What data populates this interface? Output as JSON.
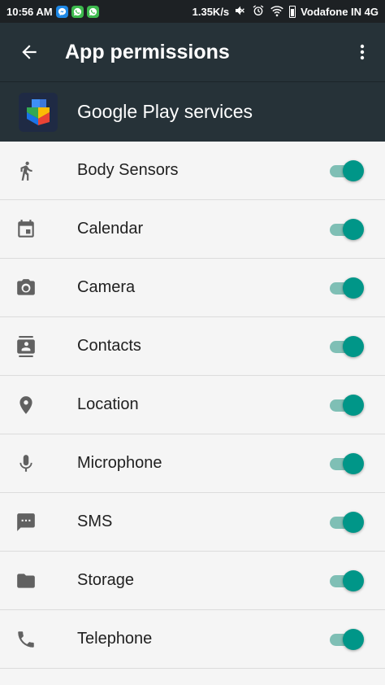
{
  "status_bar": {
    "time": "10:56 AM",
    "speed": "1.35K/s",
    "carrier": "Vodafone IN 4G",
    "notifications": [
      "messenger-icon",
      "whatsapp-icon",
      "whatsapp-icon"
    ],
    "system_icons": [
      "mute-icon",
      "alarm-icon",
      "wifi-icon",
      "battery-icon"
    ]
  },
  "toolbar": {
    "title": "App permissions",
    "back_icon": "arrow-back-icon",
    "overflow_icon": "more-vert-icon"
  },
  "app": {
    "name": "Google Play services",
    "icon": "google-play-services-icon"
  },
  "colors": {
    "toolbar": "#263238",
    "status_bar": "#1d2124",
    "accent": "#009688",
    "track": "#7fbfb5",
    "background": "#f5f5f5"
  },
  "permissions": [
    {
      "label": "Body Sensors",
      "icon": "walk-icon",
      "enabled": true
    },
    {
      "label": "Calendar",
      "icon": "calendar-icon",
      "enabled": true
    },
    {
      "label": "Camera",
      "icon": "camera-icon",
      "enabled": true
    },
    {
      "label": "Contacts",
      "icon": "contacts-icon",
      "enabled": true
    },
    {
      "label": "Location",
      "icon": "location-pin-icon",
      "enabled": true
    },
    {
      "label": "Microphone",
      "icon": "microphone-icon",
      "enabled": true
    },
    {
      "label": "SMS",
      "icon": "sms-icon",
      "enabled": true
    },
    {
      "label": "Storage",
      "icon": "folder-icon",
      "enabled": true
    },
    {
      "label": "Telephone",
      "icon": "phone-icon",
      "enabled": true
    }
  ]
}
